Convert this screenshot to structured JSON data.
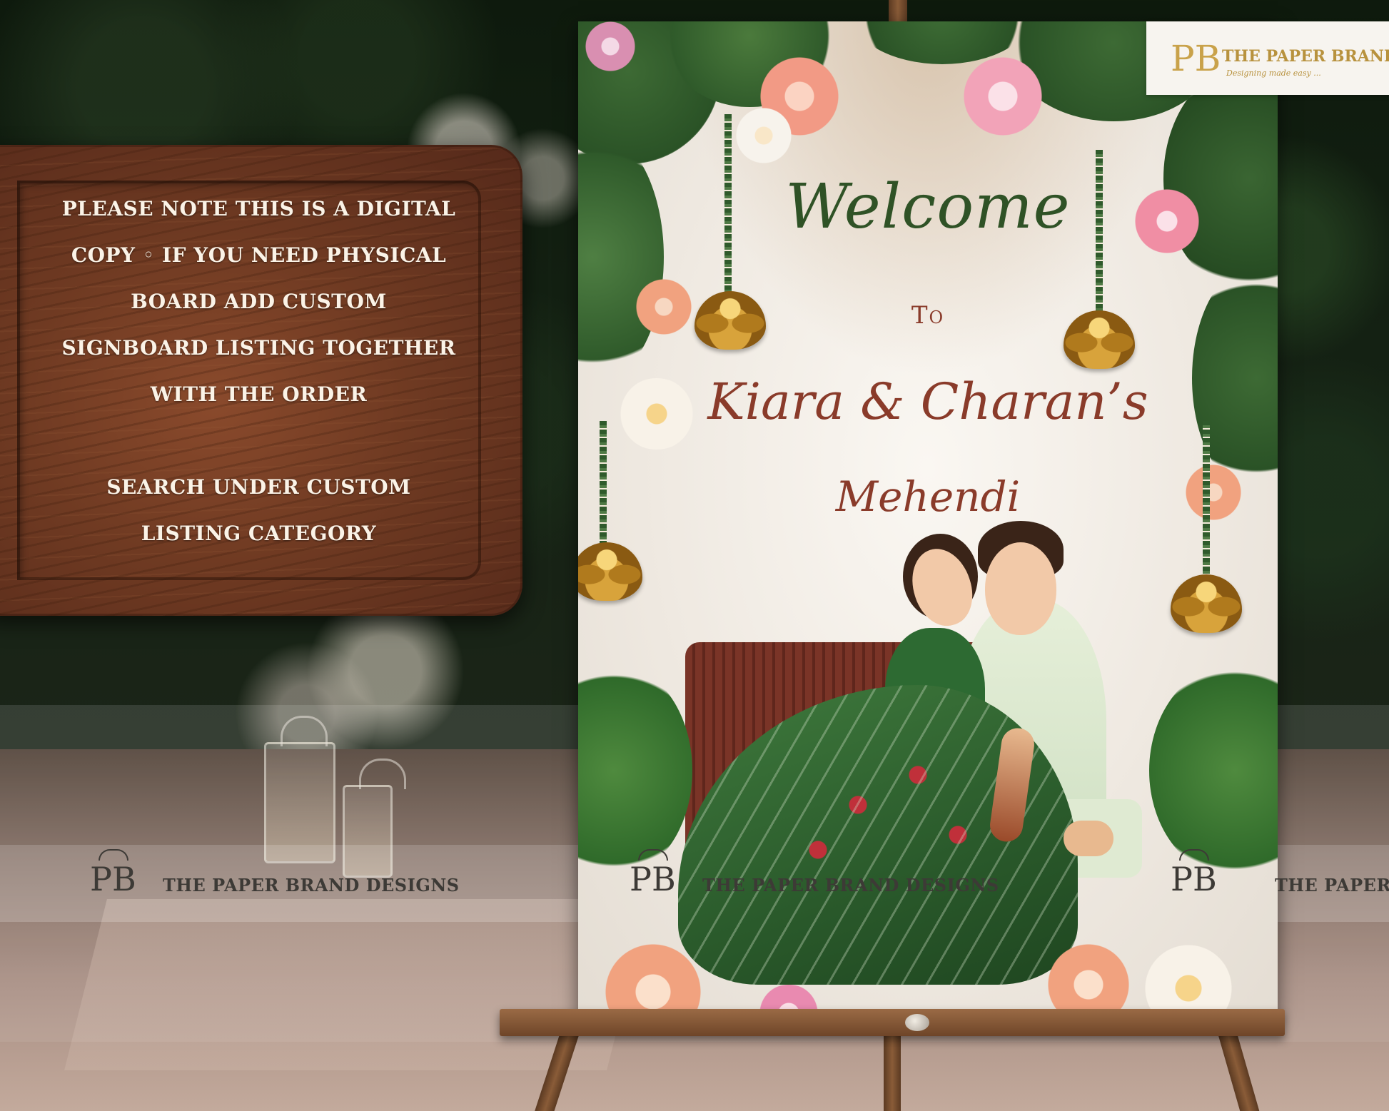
{
  "wood_board": {
    "lines": [
      "PLEASE NOTE THIS IS A DIGITAL",
      "COPY ◦ IF YOU NEED PHYSICAL",
      "BOARD ADD CUSTOM",
      "SIGNBOARD LISTING TOGETHER",
      "WITH THE ORDER",
      "SEARCH UNDER CUSTOM",
      "LISTING CATEGORY"
    ]
  },
  "sign": {
    "welcome": "Welcome",
    "to": "To",
    "names": "Kiara & Charan’s",
    "event": "Mehendi",
    "colors": {
      "welcome_green": "#2f5226",
      "names_maroon": "#8a3b2a",
      "lehenga_green": "#2a5a2b",
      "lotus_gold": "#d8a33b"
    }
  },
  "corner_logo": {
    "monogram": "PB",
    "brand": "THE PAPER BRAND",
    "tagline": "Designing made easy ..."
  },
  "watermarks": [
    {
      "monogram": "PB",
      "text": "THE PAPER BRAND DESIGNS"
    },
    {
      "monogram": "PB",
      "text": "THE PAPER BRAND DESIGNS"
    },
    {
      "monogram": "PB",
      "text": "THE PAPER BRAND"
    }
  ]
}
